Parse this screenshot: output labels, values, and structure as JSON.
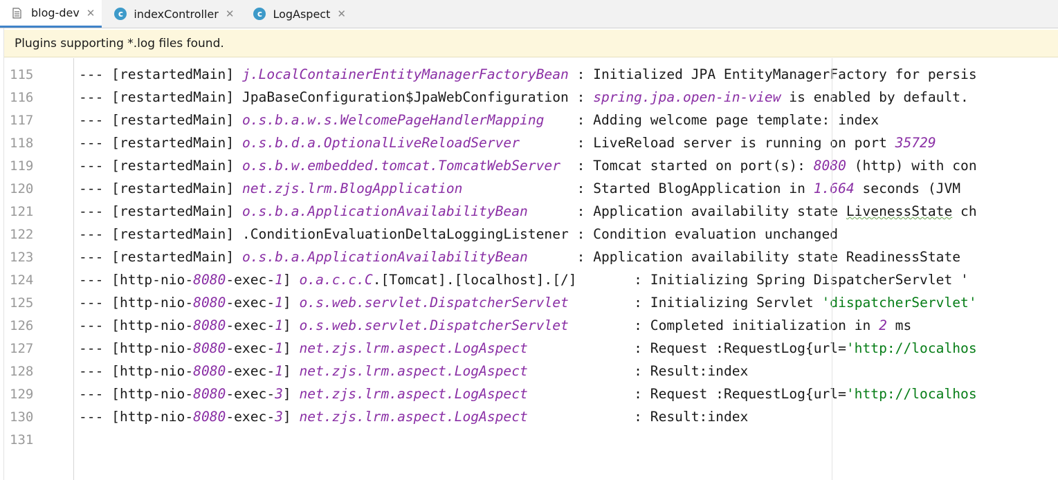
{
  "tabs": [
    {
      "label": "blog-dev",
      "icon": "log-file-icon",
      "active": true
    },
    {
      "label": "indexController",
      "icon": "class-icon",
      "active": false
    },
    {
      "label": "LogAspect",
      "icon": "class-icon",
      "active": false
    }
  ],
  "tab_class_glyph": "c",
  "tab_close_glyph": "✕",
  "banner": {
    "text": "Plugins supporting *.log files found."
  },
  "colors": {
    "accent": "#4083c9",
    "banner_bg": "#fdf7dd",
    "logger_italic": "#8a2fa5",
    "string": "#067d17",
    "line_number": "#999999"
  },
  "lines": [
    {
      "num": "115",
      "segs": [
        {
          "t": "--- [restartedMain] "
        },
        {
          "t": "j.LocalContainerEntityManagerFactoryBean",
          "c": "purple"
        },
        {
          "t": " : Initialized JPA EntityManagerFactory for persis"
        }
      ]
    },
    {
      "num": "116",
      "segs": [
        {
          "t": "--- [restartedMain] JpaBaseConfiguration$JpaWebConfiguration : "
        },
        {
          "t": "spring.jpa.open-in-view",
          "c": "purple"
        },
        {
          "t": " is enabled by default."
        }
      ]
    },
    {
      "num": "117",
      "segs": [
        {
          "t": "--- [restartedMain] "
        },
        {
          "t": "o.s.b.a.w.s.WelcomePageHandlerMapping",
          "c": "purple"
        },
        {
          "t": "    : Adding welcome page template: index"
        }
      ]
    },
    {
      "num": "118",
      "segs": [
        {
          "t": "--- [restartedMain] "
        },
        {
          "t": "o.s.b.d.a.OptionalLiveReloadServer",
          "c": "purple"
        },
        {
          "t": "       : LiveReload server is running on port "
        },
        {
          "t": "35729",
          "c": "purple"
        }
      ]
    },
    {
      "num": "119",
      "segs": [
        {
          "t": "--- [restartedMain] "
        },
        {
          "t": "o.s.b.w.embedded.tomcat.TomcatWebServer",
          "c": "purple"
        },
        {
          "t": "  : Tomcat started on port(s): "
        },
        {
          "t": "8080",
          "c": "purple"
        },
        {
          "t": " (http) with con"
        }
      ]
    },
    {
      "num": "120",
      "segs": [
        {
          "t": "--- [restartedMain] "
        },
        {
          "t": "net.zjs.lrm.BlogApplication",
          "c": "purple"
        },
        {
          "t": "              : Started BlogApplication in "
        },
        {
          "t": "1.664",
          "c": "purple"
        },
        {
          "t": " seconds (JVM "
        }
      ]
    },
    {
      "num": "121",
      "segs": [
        {
          "t": "--- [restartedMain] "
        },
        {
          "t": "o.s.b.a.ApplicationAvailabilityBean",
          "c": "purple"
        },
        {
          "t": "      : Application availability state "
        },
        {
          "t": "LivenessState",
          "c": "squiggle"
        },
        {
          "t": " ch"
        }
      ]
    },
    {
      "num": "122",
      "segs": [
        {
          "t": "--- [restartedMain] .ConditionEvaluationDeltaLoggingListener : Condition evaluation unchanged"
        }
      ]
    },
    {
      "num": "123",
      "segs": [
        {
          "t": "--- [restartedMain] "
        },
        {
          "t": "o.s.b.a.ApplicationAvailabilityBean",
          "c": "purple"
        },
        {
          "t": "      : Application availability state ReadinessState "
        }
      ]
    },
    {
      "num": "124",
      "segs": [
        {
          "t": "--- [http-nio-"
        },
        {
          "t": "8080",
          "c": "purple"
        },
        {
          "t": "-exec-"
        },
        {
          "t": "1",
          "c": "purple"
        },
        {
          "t": "] "
        },
        {
          "t": "o.a.c.c.C",
          "c": "purple"
        },
        {
          "t": ".[Tomcat].[localhost].[/]       : Initializing Spring DispatcherServlet '"
        }
      ]
    },
    {
      "num": "125",
      "segs": [
        {
          "t": "--- [http-nio-"
        },
        {
          "t": "8080",
          "c": "purple"
        },
        {
          "t": "-exec-"
        },
        {
          "t": "1",
          "c": "purple"
        },
        {
          "t": "] "
        },
        {
          "t": "o.s.web.servlet.DispatcherServlet",
          "c": "purple"
        },
        {
          "t": "        : Initializing Servlet "
        },
        {
          "t": "'dispatcherServlet'",
          "c": "green"
        }
      ]
    },
    {
      "num": "126",
      "segs": [
        {
          "t": "--- [http-nio-"
        },
        {
          "t": "8080",
          "c": "purple"
        },
        {
          "t": "-exec-"
        },
        {
          "t": "1",
          "c": "purple"
        },
        {
          "t": "] "
        },
        {
          "t": "o.s.web.servlet.DispatcherServlet",
          "c": "purple"
        },
        {
          "t": "        : Completed initialization in "
        },
        {
          "t": "2",
          "c": "purple"
        },
        {
          "t": " ms"
        }
      ]
    },
    {
      "num": "127",
      "segs": [
        {
          "t": "--- [http-nio-"
        },
        {
          "t": "8080",
          "c": "purple"
        },
        {
          "t": "-exec-"
        },
        {
          "t": "1",
          "c": "purple"
        },
        {
          "t": "] "
        },
        {
          "t": "net.zjs.lrm.aspect.LogAspect",
          "c": "purple"
        },
        {
          "t": "             : Request :RequestLog{url="
        },
        {
          "t": "'http://localhos",
          "c": "green"
        }
      ]
    },
    {
      "num": "128",
      "segs": [
        {
          "t": "--- [http-nio-"
        },
        {
          "t": "8080",
          "c": "purple"
        },
        {
          "t": "-exec-"
        },
        {
          "t": "1",
          "c": "purple"
        },
        {
          "t": "] "
        },
        {
          "t": "net.zjs.lrm.aspect.LogAspect",
          "c": "purple"
        },
        {
          "t": "             : Result:index"
        }
      ]
    },
    {
      "num": "129",
      "segs": [
        {
          "t": "--- [http-nio-"
        },
        {
          "t": "8080",
          "c": "purple"
        },
        {
          "t": "-exec-"
        },
        {
          "t": "3",
          "c": "purple"
        },
        {
          "t": "] "
        },
        {
          "t": "net.zjs.lrm.aspect.LogAspect",
          "c": "purple"
        },
        {
          "t": "             : Request :RequestLog{url="
        },
        {
          "t": "'http://localhos",
          "c": "green"
        }
      ]
    },
    {
      "num": "130",
      "segs": [
        {
          "t": "--- [http-nio-"
        },
        {
          "t": "8080",
          "c": "purple"
        },
        {
          "t": "-exec-"
        },
        {
          "t": "3",
          "c": "purple"
        },
        {
          "t": "] "
        },
        {
          "t": "net.zjs.lrm.aspect.LogAspect",
          "c": "purple"
        },
        {
          "t": "             : Result:index"
        }
      ]
    },
    {
      "num": "131",
      "segs": []
    }
  ]
}
